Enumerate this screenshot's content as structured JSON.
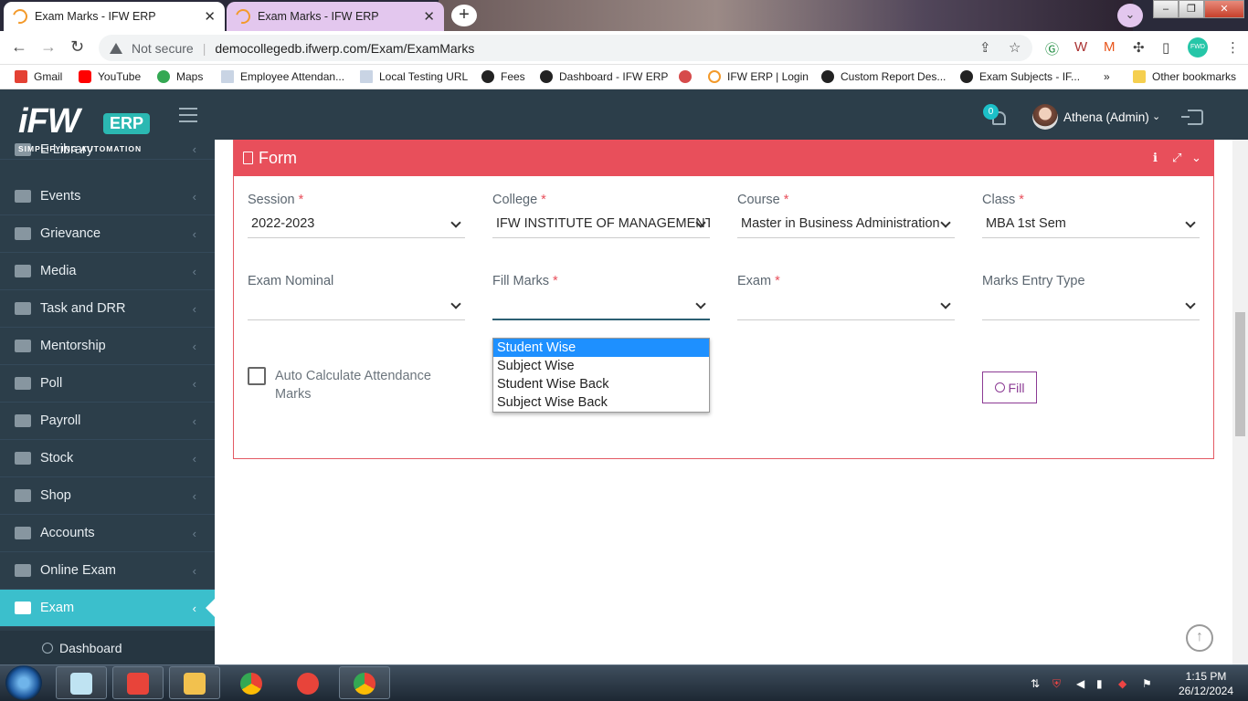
{
  "browser": {
    "tabs": [
      {
        "title": "Exam Marks - IFW ERP",
        "active": true
      },
      {
        "title": "Exam Marks - IFW ERP",
        "active": false
      }
    ],
    "new_tab_symbol": "+",
    "address": {
      "security_text": "Not secure",
      "url": "democollegedb.ifwerp.com/Exam/ExamMarks"
    },
    "extension_label": "FWD",
    "bookmarks": [
      {
        "label": "Gmail",
        "icon": "gmail-icon"
      },
      {
        "label": "YouTube",
        "icon": "youtube-icon"
      },
      {
        "label": "Maps",
        "icon": "maps-icon"
      },
      {
        "label": "Employee Attendan...",
        "icon": "doc-icon"
      },
      {
        "label": "Local Testing URL",
        "icon": "doc-icon"
      },
      {
        "label": "Fees",
        "icon": "globe-icon"
      },
      {
        "label": "Dashboard - IFW ERP",
        "icon": "globe-icon"
      },
      {
        "label": "",
        "icon": "record-icon"
      },
      {
        "label": "IFW ERP | Login",
        "icon": "ifw-icon"
      },
      {
        "label": "Custom Report Des...",
        "icon": "globe-icon"
      },
      {
        "label": "Exam Subjects - IF...",
        "icon": "globe-icon"
      }
    ],
    "more_bookmarks": "»",
    "other_bookmarks": "Other bookmarks"
  },
  "app": {
    "logo_text": "iFW",
    "logo_badge": "ERP",
    "logo_tagline": "SIMPLIFYING AUTOMATION",
    "notification_count": "0",
    "user_name": "Athena (Admin)"
  },
  "sidebar": {
    "items": [
      {
        "label": "E Library",
        "icon": "megaphone-icon"
      },
      {
        "label": "Events",
        "icon": "trophy-icon"
      },
      {
        "label": "Grievance",
        "icon": "gavel-icon"
      },
      {
        "label": "Media",
        "icon": "eye-icon"
      },
      {
        "label": "Task and DRR",
        "icon": "handshake-icon"
      },
      {
        "label": "Mentorship",
        "icon": "users-icon"
      },
      {
        "label": "Poll",
        "icon": "comment-icon"
      },
      {
        "label": "Payroll",
        "icon": "mobile-icon"
      },
      {
        "label": "Stock",
        "icon": "cubes-icon"
      },
      {
        "label": "Shop",
        "icon": "cart-icon"
      },
      {
        "label": "Accounts",
        "icon": "money-icon"
      },
      {
        "label": "Online Exam",
        "icon": "desktop-icon"
      },
      {
        "label": "Exam",
        "icon": "bar-chart-icon",
        "active": true
      }
    ],
    "sub_items": [
      {
        "label": "Dashboard"
      }
    ]
  },
  "form": {
    "title": "Form",
    "fields": {
      "session": {
        "label": "Session",
        "required": "*",
        "value": "2022-2023"
      },
      "college": {
        "label": "College",
        "required": "*",
        "value": "IFW INSTITUTE OF MANAGEMENT"
      },
      "course": {
        "label": "Course",
        "required": "*",
        "value": "Master in Business Administration"
      },
      "class": {
        "label": "Class",
        "required": "*",
        "value": "MBA 1st Sem"
      },
      "exam_nominal": {
        "label": "Exam Nominal",
        "value": ""
      },
      "fill_marks": {
        "label": "Fill Marks",
        "required": "*",
        "value": ""
      },
      "exam": {
        "label": "Exam",
        "required": "*",
        "value": ""
      },
      "marks_entry_type": {
        "label": "Marks Entry Type",
        "value": ""
      }
    },
    "fill_marks_options": [
      "Student Wise",
      "Subject Wise",
      "Student Wise Back",
      "Subject Wise Back"
    ],
    "highlighted_option": "Student Wise",
    "auto_calc_label": "Auto Calculate Attendance Marks",
    "auto_calc_checked": false,
    "fill_button": "Fill"
  },
  "taskbar": {
    "time": "1:15 PM",
    "date": "26/12/2024"
  },
  "colors": {
    "sidebar_bg": "#2c3e4a",
    "panel_header": "#e84f5b",
    "active_item": "#3bbfcc",
    "fill_button": "#8c3b94",
    "option_highlight": "#1e90ff"
  }
}
